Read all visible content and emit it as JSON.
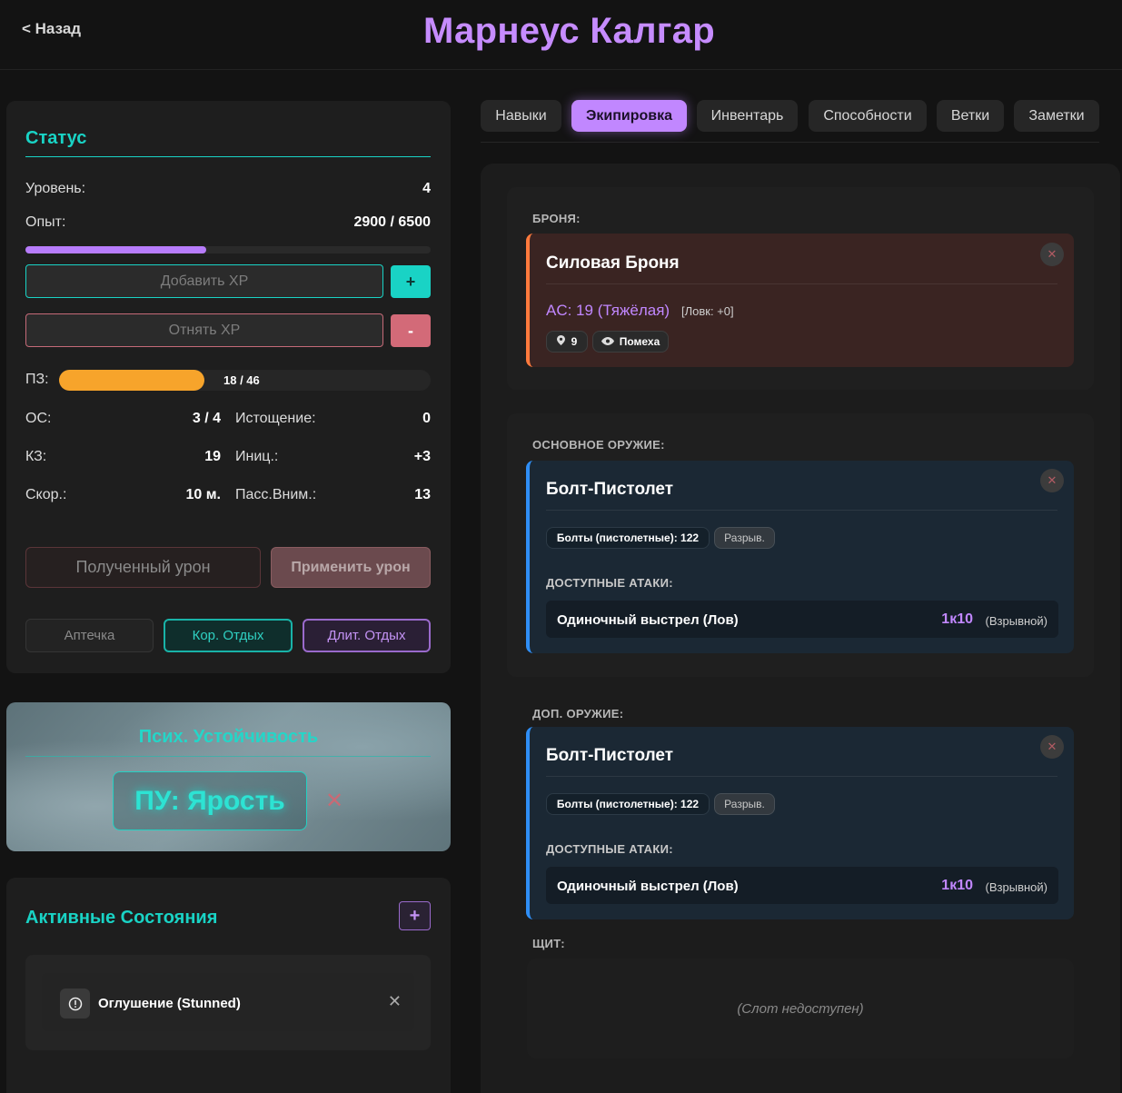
{
  "header": {
    "back_label": "< Назад",
    "title": "Марнеус Калгар"
  },
  "status": {
    "title": "Статус",
    "level_label": "Уровень:",
    "level_value": "4",
    "xp_label": "Опыт:",
    "xp_value": "2900 / 6500",
    "xp_progress": 0.446,
    "add_xp_placeholder": "Добавить XP",
    "add_xp_button": "+",
    "sub_xp_placeholder": "Отнять XP",
    "sub_xp_button": "-",
    "hp_label": "ПЗ:",
    "hp_value": "18 / 46",
    "hp_progress": 0.391,
    "os_label": "ОС:",
    "os_value": "3 / 4",
    "exhaust_label": "Истощение:",
    "exhaust_value": "0",
    "ac_label": "КЗ:",
    "ac_value": "19",
    "init_label": "Иниц.:",
    "init_value": "+3",
    "speed_label": "Скор.:",
    "speed_value": "10 м.",
    "perc_label": "Пасс.Вним.:",
    "perc_value": "13",
    "damage_placeholder": "Полученный урон",
    "apply_damage": "Применить урон",
    "rest": [
      "Аптечка",
      "Кор. Отдых",
      "Длит. Отдых"
    ]
  },
  "psych": {
    "title": "Псих. Устойчивость",
    "state": "ПУ: Ярость",
    "close": "✕"
  },
  "conditions": {
    "title": "Активные Состояния",
    "add": "+",
    "items": [
      {
        "name": "Оглушение (Stunned)",
        "icon": "alert-circle-icon"
      }
    ]
  },
  "tabs": [
    "Навыки",
    "Экипировка",
    "Инвентарь",
    "Способности",
    "Ветки",
    "Заметки"
  ],
  "active_tab": "Экипировка",
  "equipment": {
    "armor_label": "БРОНЯ:",
    "armor": {
      "name": "Силовая Броня",
      "ac": "AC: 19 (Тяжёлая)",
      "dex": "[Ловк: +0]",
      "weight": "9",
      "stealth": "Помеха"
    },
    "main_label": "ОСНОВНОЕ ОРУЖИЕ:",
    "main": {
      "name": "Болт-Пистолет",
      "ammo": "Болты (пистолетные): 122",
      "tag": "Разрыв.",
      "attacks_label": "ДОСТУПНЫЕ АТАКИ:",
      "attack_name": "Одиночный выстрел (Лов)",
      "dice": "1к10",
      "dmg_type": "(Взрывной)"
    },
    "off_label": "ДОП. ОРУЖИЕ:",
    "off": {
      "name": "Болт-Пистолет",
      "ammo": "Болты (пистолетные): 122",
      "tag": "Разрыв.",
      "attacks_label": "ДОСТУПНЫЕ АТАКИ:",
      "attack_name": "Одиночный выстрел (Лов)",
      "dice": "1к10",
      "dmg_type": "(Взрывной)"
    },
    "shield_label": "ЩИТ:",
    "shield_empty": "(Слот недоступен)",
    "remove": "✕"
  }
}
